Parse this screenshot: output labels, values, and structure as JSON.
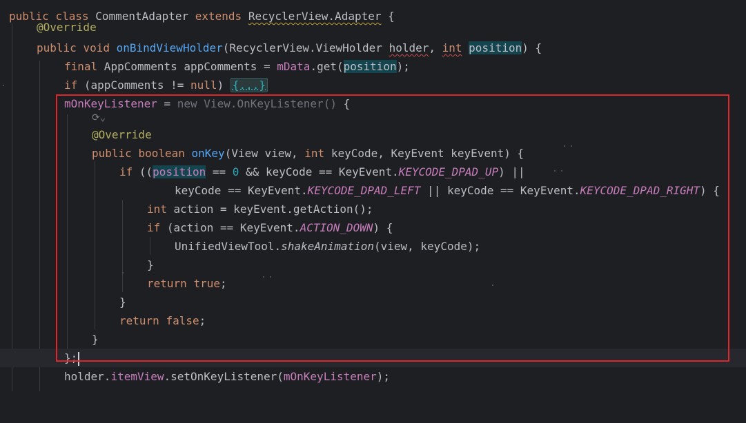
{
  "editor": {
    "lines": {
      "l0": {
        "kw1": "public",
        "kw2": "class",
        "name": "CommentAdapter",
        "kw3": "extends",
        "sup": "RecyclerView.Adapter",
        "tail": " {"
      },
      "l1": {
        "ann": "@Override"
      },
      "l2": {
        "kw1": "public",
        "kw2": "void",
        "fn": "onBindViewHolder",
        "p1": "(RecyclerView.ViewHolder ",
        "holder": "holder",
        "comma": ", ",
        "kwint": "int",
        "sp": " ",
        "pos": "position",
        "tail": ") {"
      },
      "l3": {
        "kw": "final",
        "t1": " AppComments appComments = ",
        "field": "mData",
        "t2": ".get(",
        "pos": "position",
        "t3": ");"
      },
      "l4": {
        "kw": "if",
        "t1": " (appComments != ",
        "kwnull": "null",
        "t2": ") ",
        "fold": "{...}"
      },
      "l5": {
        "field": "mOnKeyListener",
        "t1": " = ",
        "new": "new View.OnKeyListener()",
        "t2": " {"
      },
      "l6": {
        "hint": "⟳⌄"
      },
      "l7": {
        "ann": "@Override"
      },
      "l8": {
        "kw1": "public",
        "kw2": "boolean",
        "fn": "onKey",
        "t1": "(View view, ",
        "kwint": "int",
        "t2": " keyCode, KeyEvent keyEvent) {"
      },
      "l9": {
        "kw": "if",
        "t1": " ((",
        "pos": "position",
        "t2": " == ",
        "num": "0",
        "t3": " && keyCode == KeyEvent.",
        "cst": "KEYCODE_DPAD_UP",
        "t4": ") ||"
      },
      "l10": {
        "t1": "keyCode == KeyEvent.",
        "cst1": "KEYCODE_DPAD_LEFT",
        "t2": " || keyCode == KeyEvent.",
        "cst2": "KEYCODE_DPAD_RIGHT",
        "t3": ") {"
      },
      "l11": {
        "kwint": "int",
        "t1": " action = keyEvent.getAction();"
      },
      "l12": {
        "kw": "if",
        "t1": " (action == KeyEvent.",
        "cst": "ACTION_DOWN",
        "t2": ") {"
      },
      "l13": {
        "t1": "UnifiedViewTool.",
        "st": "shakeAnimation",
        "t2": "(view, keyCode);"
      },
      "l14": {
        "t1": "}"
      },
      "l15": {
        "kw": "return",
        "sp": " ",
        "kwt": "true",
        "t1": ";"
      },
      "l16": {
        "t1": "}"
      },
      "l17": {
        "kw": "return",
        "sp": " ",
        "kwf": "false",
        "t1": ";"
      },
      "l18": {
        "t1": "}"
      },
      "l19": {
        "t1": "};"
      },
      "l20": {
        "t1": "holder.",
        "field": "itemView",
        "t2": ".setOnKeyListener(",
        "field2": "mOnKeyListener",
        "t3": ");"
      }
    }
  }
}
